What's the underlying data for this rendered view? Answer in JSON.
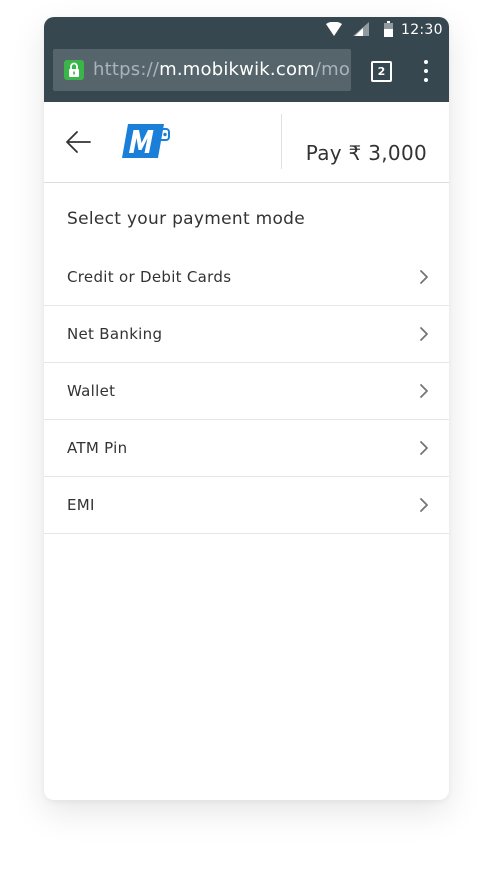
{
  "status_bar": {
    "time": "12:30",
    "icons": [
      "wifi-icon",
      "signal-icon",
      "battery-icon"
    ]
  },
  "browser": {
    "url_scheme": "https://",
    "url_host": "m.mobikwik.com",
    "url_path": "/mobil",
    "tab_count": "2",
    "secure_icon": "lock-icon",
    "menu_icon": "overflow-menu-icon"
  },
  "header": {
    "back_icon": "back-arrow-icon",
    "logo_icon": "mobikwik-logo",
    "pay_label": "Pay ₹ 3,000"
  },
  "content": {
    "title": "Select your payment mode",
    "payment_modes": [
      {
        "label": "Credit or Debit Cards"
      },
      {
        "label": "Net Banking"
      },
      {
        "label": "Wallet"
      },
      {
        "label": "ATM Pin"
      },
      {
        "label": "EMI"
      }
    ],
    "chevron_icon": "chevron-right-icon"
  },
  "colors": {
    "toolbar": "#37474f",
    "url_field": "#56656c",
    "secure_lock": "#3ab54a",
    "logo_blue": "#1a7fd8",
    "text": "#333333",
    "divider": "#e6e6e6"
  }
}
